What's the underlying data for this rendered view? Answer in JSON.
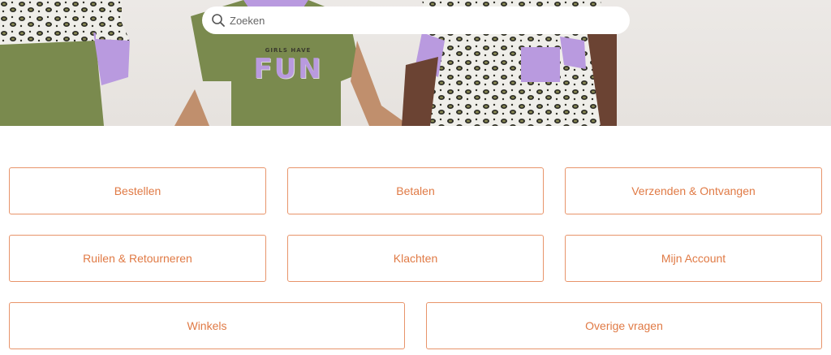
{
  "search": {
    "placeholder": "Zoeken"
  },
  "hero": {
    "shirt_text_small": "GIRLS HAVE",
    "shirt_text_big": "FUN"
  },
  "categories": [
    {
      "label": "Bestellen"
    },
    {
      "label": "Betalen"
    },
    {
      "label": "Verzenden & Ontvangen"
    },
    {
      "label": "Ruilen & Retourneren"
    },
    {
      "label": "Klachten"
    },
    {
      "label": "Mijn Account"
    },
    {
      "label": "Winkels"
    },
    {
      "label": "Overige vragen"
    }
  ],
  "colors": {
    "accent": "#e07a45",
    "border": "#e8946a",
    "shirt_green": "#7a8a4e",
    "sleeve_lilac": "#b99adf"
  }
}
